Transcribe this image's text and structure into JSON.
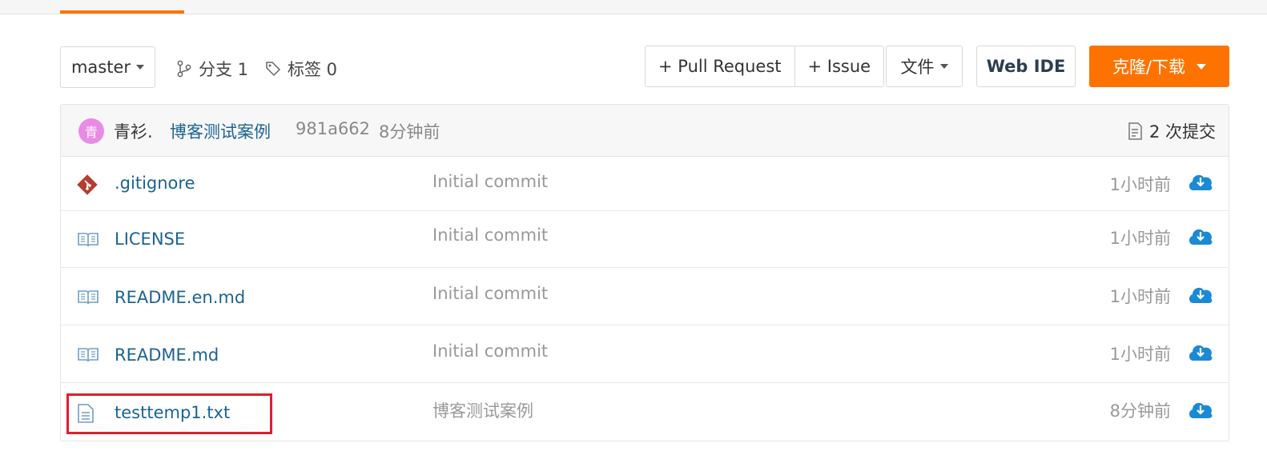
{
  "branch": {
    "label": "master"
  },
  "meta": {
    "branches": "分支 1",
    "tags": "标签 0"
  },
  "actions": {
    "pull_request": "+ Pull Request",
    "issue": "+ Issue",
    "files": "文件",
    "web_ide": "Web IDE",
    "clone": "克隆/下载"
  },
  "commit": {
    "avatar_text": "青",
    "author": "青衫.",
    "message": "博客测试案例",
    "sha": "981a662",
    "time": "8分钟前",
    "count": "2 次提交"
  },
  "files": [
    {
      "name": ".gitignore",
      "icon": "git-file-icon",
      "message": "Initial commit",
      "time": "1小时前"
    },
    {
      "name": "LICENSE",
      "icon": "book-icon",
      "message": "Initial commit",
      "time": "1小时前"
    },
    {
      "name": "README.en.md",
      "icon": "book-icon",
      "message": "Initial commit",
      "time": "1小时前"
    },
    {
      "name": "README.md",
      "icon": "book-icon",
      "message": "Initial commit",
      "time": "1小时前"
    },
    {
      "name": "testtemp1.txt",
      "icon": "text-file-icon",
      "message": "博客测试案例",
      "time": "8分钟前"
    }
  ],
  "colors": {
    "accent": "#fe7300",
    "link": "#1c6391",
    "download": "#1a8ad4",
    "highlight": "#e11d2b",
    "avatar": "#e88be4"
  }
}
